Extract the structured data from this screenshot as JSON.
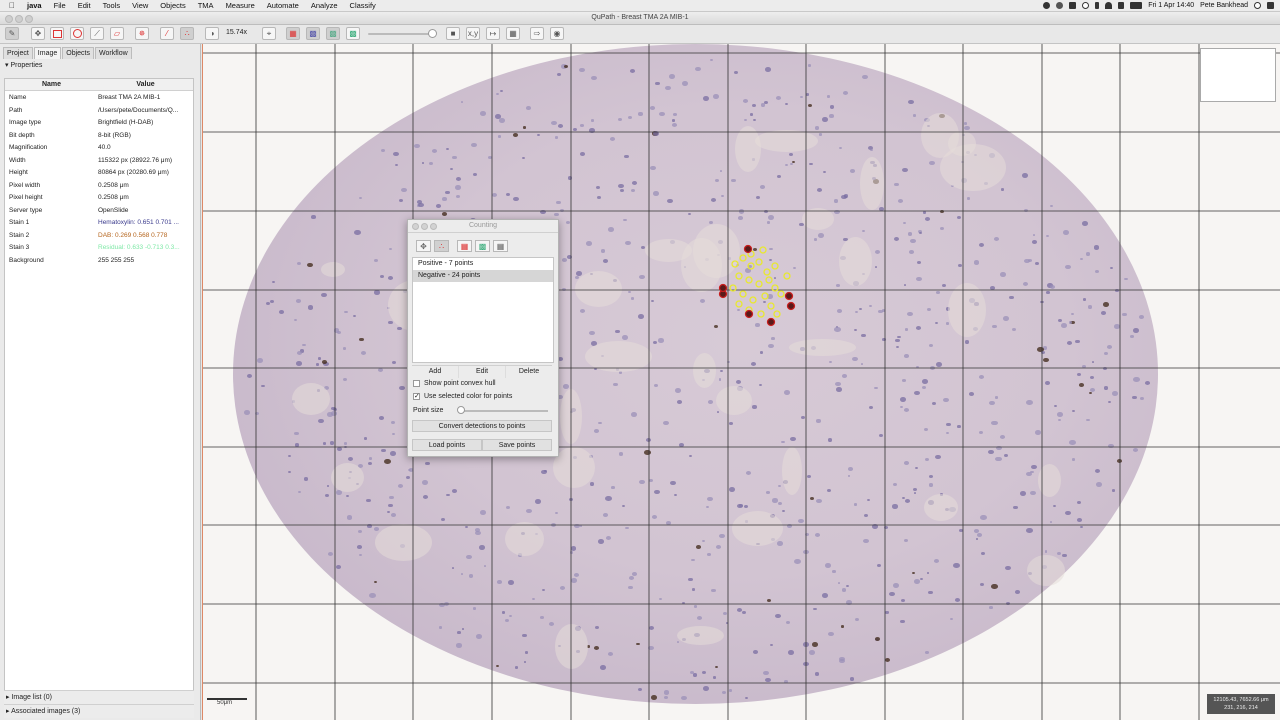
{
  "menubar": {
    "apple": "",
    "items": [
      "java",
      "File",
      "Edit",
      "Tools",
      "View",
      "Objects",
      "TMA",
      "Measure",
      "Automate",
      "Analyze",
      "Classify"
    ],
    "clock": "Fri 1 Apr  14:40",
    "user": "Pete Bankhead"
  },
  "window": {
    "title": "QuPath - Breast TMA 2A MIB-1"
  },
  "toolbar": {
    "zoom": "15.74x"
  },
  "left_panel": {
    "tabs": [
      "Project",
      "Image",
      "Objects",
      "Workflow"
    ],
    "properties_header": "Properties",
    "table": {
      "headers": [
        "Name",
        "Value"
      ],
      "rows": [
        {
          "k": "Name",
          "v": "Breast TMA 2A MIB-1"
        },
        {
          "k": "Path",
          "v": "/Users/pete/Documents/Q..."
        },
        {
          "k": "Image type",
          "v": "Brightfield (H-DAB)"
        },
        {
          "k": "Bit depth",
          "v": "8-bit (RGB)"
        },
        {
          "k": "Magnification",
          "v": "40.0"
        },
        {
          "k": "Width",
          "v": "115322 px (28922.76 μm)"
        },
        {
          "k": "Height",
          "v": "80864 px (20280.69 μm)"
        },
        {
          "k": "Pixel width",
          "v": "0.2508 μm"
        },
        {
          "k": "Pixel height",
          "v": "0.2508 μm"
        },
        {
          "k": "Server type",
          "v": "OpenSlide"
        },
        {
          "k": "Stain 1",
          "v": "Hematoxylin: 0.651 0.701 ..."
        },
        {
          "k": "Stain 2",
          "v": "DAB: 0.269 0.568 0.778"
        },
        {
          "k": "Stain 3",
          "v": "Residual: 0.633 -0.713 0.3..."
        },
        {
          "k": "Background",
          "v": "255 255 255"
        }
      ]
    },
    "stain_colors": {
      "stain1": "#3a3a8c",
      "stain2": "#b5651d",
      "stain3": "#7ee8a6"
    },
    "bottom": [
      "Image list (0)",
      "Associated images (3)"
    ]
  },
  "viewer": {
    "scalebar": "50μm",
    "coords_line1": "12105.43, 7652.66 μm",
    "coords_line2": "231, 216, 214"
  },
  "counting": {
    "title": "Counting",
    "list": [
      "Positive - 7 points",
      "Negative - 24 points"
    ],
    "buttons": [
      "Add",
      "Edit",
      "Delete"
    ],
    "convex_hull": "Show point convex hull",
    "selected_color": "Use selected color for points",
    "point_size": "Point size",
    "convert": "Convert detections to points",
    "load": "Load points",
    "save": "Save points"
  }
}
